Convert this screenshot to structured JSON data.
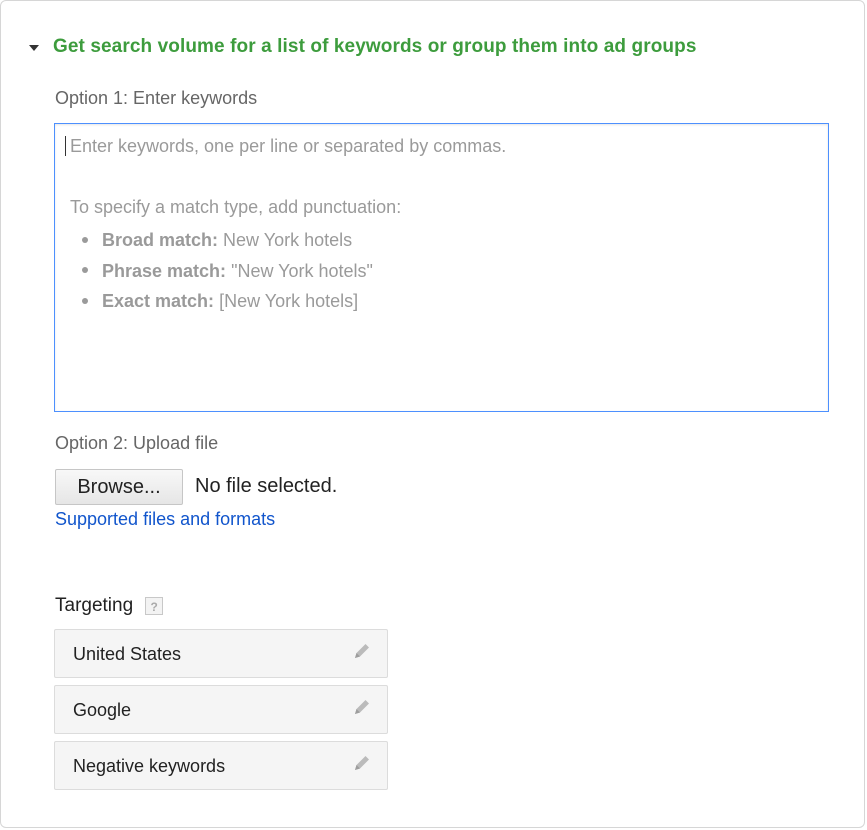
{
  "section": {
    "title": "Get search volume for a list of keywords or group them into ad groups"
  },
  "option1": {
    "label": "Option 1: Enter keywords",
    "placeholder_line1": "Enter keywords, one per line or separated by commas.",
    "placeholder_line2": "To specify a match type, add punctuation:",
    "match_types": [
      {
        "name": "Broad match:",
        "example": "New York hotels"
      },
      {
        "name": "Phrase match:",
        "example": "\"New York hotels\""
      },
      {
        "name": "Exact match:",
        "example": "[New York hotels]"
      }
    ]
  },
  "option2": {
    "label": "Option 2: Upload file",
    "browse_label": "Browse...",
    "file_status": "No file selected.",
    "supported_link": "Supported files and formats"
  },
  "targeting": {
    "label": "Targeting",
    "help": "?",
    "items": [
      {
        "label": "United States"
      },
      {
        "label": "Google"
      },
      {
        "label": "Negative keywords"
      }
    ]
  },
  "colors": {
    "section_title": "#3d9c3d",
    "link": "#1155cc",
    "focus_border": "#4d90fe"
  },
  "icons": {
    "collapse": "triangle-down-icon",
    "edit": "pencil-icon",
    "help": "help-icon"
  }
}
